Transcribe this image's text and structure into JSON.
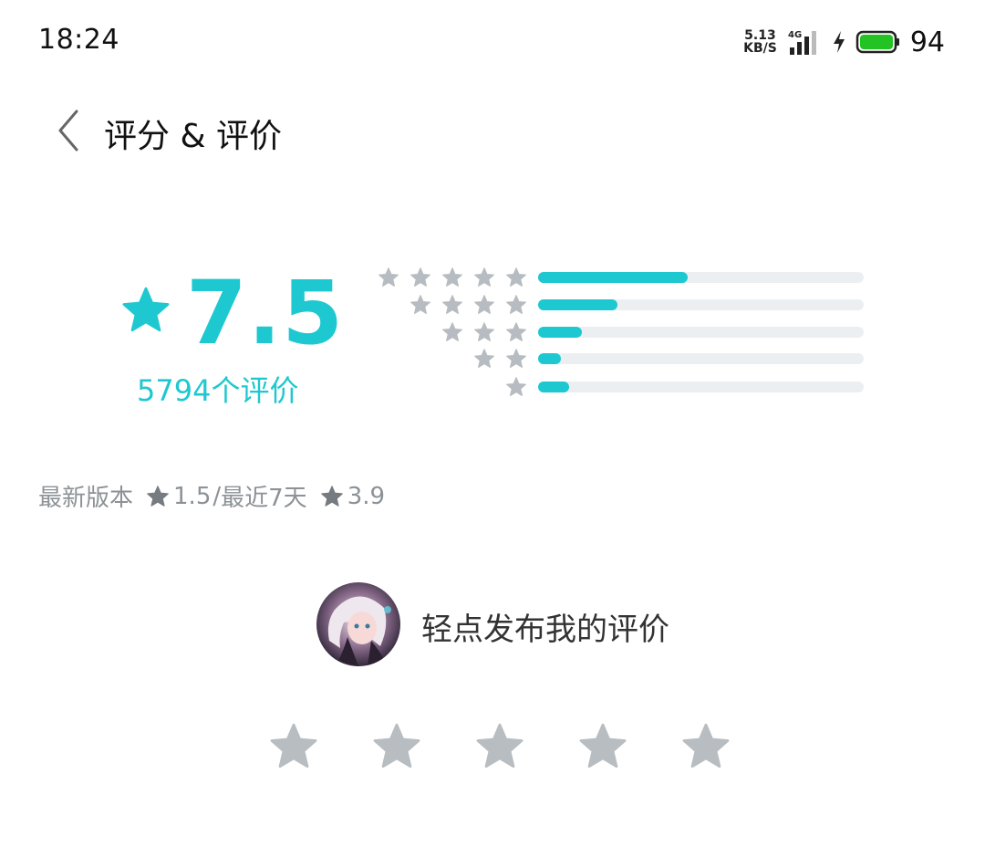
{
  "status_bar": {
    "time": "18:24",
    "net_speed_value": "5.13",
    "net_speed_unit": "KB/S",
    "network": "4G",
    "battery_percent": "94"
  },
  "header": {
    "title": "评分 & 评价",
    "back_icon": "chevron-left-icon"
  },
  "summary": {
    "score": "7.5",
    "rating_count": "5794个评价",
    "accent_color": "#1ec8d0"
  },
  "distribution": [
    {
      "stars": 5,
      "fraction": 0.46
    },
    {
      "stars": 4,
      "fraction": 0.245
    },
    {
      "stars": 3,
      "fraction": 0.135
    },
    {
      "stars": 2,
      "fraction": 0.07
    },
    {
      "stars": 1,
      "fraction": 0.095
    }
  ],
  "version_info": {
    "latest_label": "最新版本",
    "latest_score": "1.5",
    "separator": "/",
    "recent_label": "最近7天",
    "recent_score": "3.9"
  },
  "compose": {
    "prompt": "轻点发布我的评价",
    "star_count": 5
  }
}
